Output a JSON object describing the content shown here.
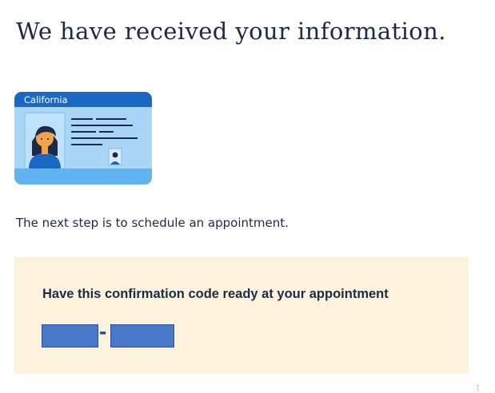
{
  "page": {
    "heading": "We have received your information.",
    "intro": "The next step is to schedule an appointment."
  },
  "id_card": {
    "state_label": "California",
    "colors": {
      "header": "#1a67c4",
      "body": "#a9d6f6",
      "footer": "#5fb4f0",
      "lines": "#1b2a47"
    }
  },
  "confirmation": {
    "heading": "Have this confirmation code ready at your appointment",
    "separator": "-",
    "redacted": true
  },
  "colors": {
    "text": "#1b2a47",
    "panel_background": "#fdf3dc",
    "redaction": "#4a78c8"
  }
}
